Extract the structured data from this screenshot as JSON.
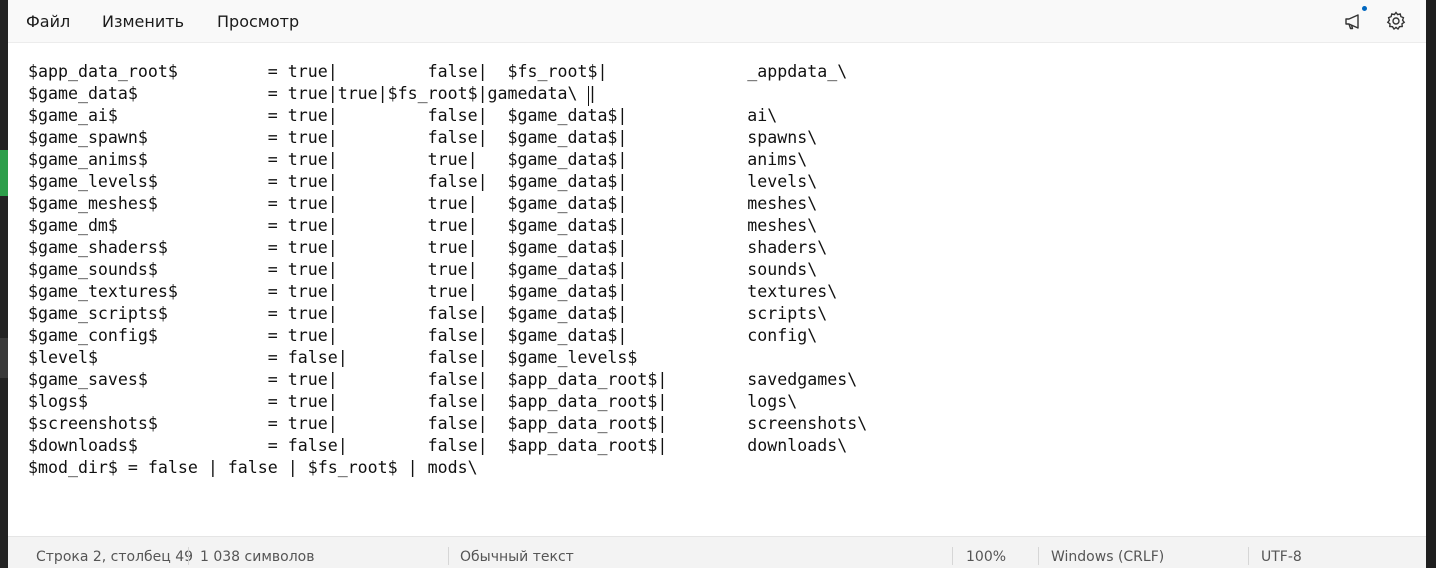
{
  "menu": {
    "file": "Файл",
    "edit": "Изменить",
    "view": "Просмотр"
  },
  "icons": {
    "announce": "megaphone-icon",
    "settings": "gear-icon",
    "accent_color": "#0067c0"
  },
  "editor": {
    "lines": [
      "$app_data_root$         = true|         false|  $fs_root$|              _appdata_\\",
      "$game_data$             = true|true|$fs_root$|gamedata\\ |",
      "$game_ai$               = true|         false|  $game_data$|            ai\\",
      "$game_spawn$            = true|         false|  $game_data$|            spawns\\",
      "$game_anims$            = true|         true|   $game_data$|            anims\\",
      "$game_levels$           = true|         false|  $game_data$|            levels\\",
      "$game_meshes$           = true|         true|   $game_data$|            meshes\\",
      "$game_dm$               = true|         true|   $game_data$|            meshes\\",
      "$game_shaders$          = true|         true|   $game_data$|            shaders\\",
      "$game_sounds$           = true|         true|   $game_data$|            sounds\\",
      "$game_textures$         = true|         true|   $game_data$|            textures\\",
      "$game_scripts$          = true|         false|  $game_data$|            scripts\\",
      "$game_config$           = true|         false|  $game_data$|            config\\",
      "$level$                 = false|        false|  $game_levels$",
      "$game_saves$            = true|         false|  $app_data_root$|        savedgames\\",
      "$logs$                  = true|         false|  $app_data_root$|        logs\\",
      "$screenshots$           = true|         false|  $app_data_root$|        screenshots\\",
      "$downloads$             = false|        false|  $app_data_root$|        downloads\\",
      "$mod_dir$ = false | false | $fs_root$ | mods\\"
    ]
  },
  "status": {
    "position": "Строка 2, столбец 49",
    "chars": "1 038 символов",
    "type": "Обычный текст",
    "zoom": "100%",
    "line_ending": "Windows (CRLF)",
    "encoding": "UTF-8"
  }
}
